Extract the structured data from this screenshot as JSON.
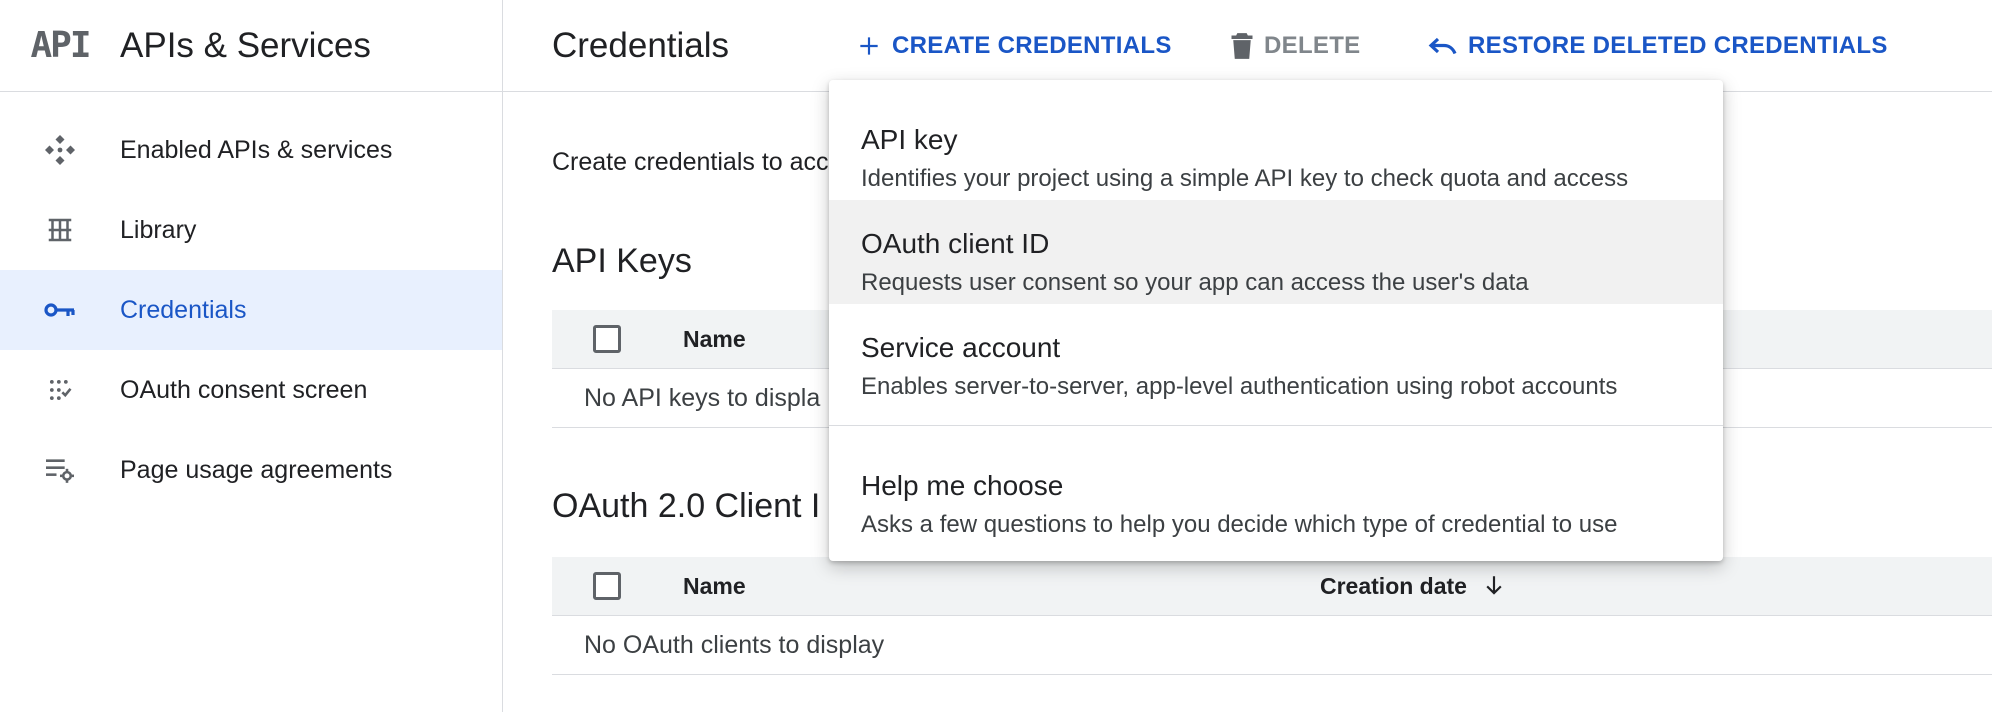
{
  "brand": {
    "logo_text": "API",
    "title": "APIs & Services"
  },
  "sidebar": {
    "items": [
      {
        "label": "Enabled APIs & services",
        "icon": "enabled-apis-icon",
        "active": false
      },
      {
        "label": "Library",
        "icon": "library-icon",
        "active": false
      },
      {
        "label": "Credentials",
        "icon": "key-icon",
        "active": true
      },
      {
        "label": "OAuth consent screen",
        "icon": "consent-screen-icon",
        "active": false
      },
      {
        "label": "Page usage agreements",
        "icon": "page-settings-icon",
        "active": false
      }
    ]
  },
  "topbar": {
    "title": "Credentials",
    "create_label": "CREATE CREDENTIALS",
    "delete_label": "DELETE",
    "restore_label": "RESTORE DELETED CREDENTIALS"
  },
  "main": {
    "intro": "Create credentials to acc",
    "api_keys": {
      "title": "API Keys",
      "col_name": "Name",
      "empty": "No API keys to displa"
    },
    "oauth": {
      "title": "OAuth 2.0 Client I",
      "col_name": "Name",
      "col_date": "Creation date",
      "empty": "No OAuth clients to display"
    }
  },
  "menu": {
    "items": [
      {
        "title": "API key",
        "desc": "Identifies your project using a simple API key to check quota and access"
      },
      {
        "title": "OAuth client ID",
        "desc": "Requests user consent so your app can access the user's data",
        "highlighted": true
      },
      {
        "title": "Service account",
        "desc": "Enables server-to-server, app-level authentication using robot accounts"
      },
      {
        "title": "Help me choose",
        "desc": "Asks a few questions to help you decide which type of credential to use"
      }
    ]
  },
  "colors": {
    "accent": "#1a56c6",
    "active_bg": "#e8f0fe",
    "hover_bg": "#f1f1f1",
    "table_header_bg": "#f1f3f4",
    "divider": "#dadce0",
    "icon_gray": "#5f6368"
  }
}
